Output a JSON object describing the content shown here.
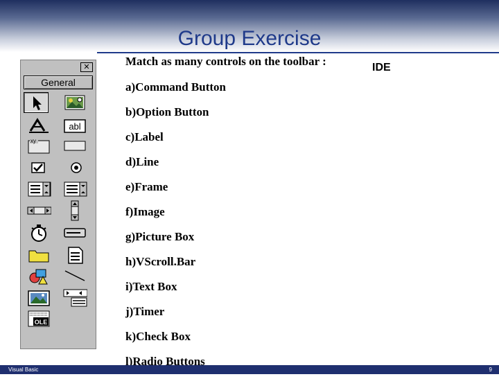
{
  "slide": {
    "title": "Group Exercise",
    "prompt": "Match as many controls on the toolbar :",
    "ide_label": "IDE",
    "options": [
      "a)Command Button",
      "b)Option Button",
      "c)Label",
      "d)Line",
      "e)Frame",
      "f)Image",
      "g)Picture Box",
      "h)VScroll.Bar",
      "i)Text Box",
      "j)Timer",
      "k)Check Box",
      "l)Radio Buttons"
    ]
  },
  "toolbox": {
    "close_glyph": "✕",
    "tab_label": "General",
    "tools": [
      {
        "icon": "pointer-icon",
        "label": ""
      },
      {
        "icon": "picturebox-icon",
        "label": ""
      },
      {
        "icon": "label-icon",
        "label": "A"
      },
      {
        "icon": "textbox-icon",
        "label": "abl"
      },
      {
        "icon": "frame-icon",
        "label": "xy"
      },
      {
        "icon": "commandbutton-icon",
        "label": ""
      },
      {
        "icon": "checkbox-icon",
        "label": ""
      },
      {
        "icon": "optionbutton-icon",
        "label": ""
      },
      {
        "icon": "combobox-icon",
        "label": ""
      },
      {
        "icon": "listbox-icon",
        "label": ""
      },
      {
        "icon": "hscrollbar-icon",
        "label": ""
      },
      {
        "icon": "vscrollbar-icon",
        "label": ""
      },
      {
        "icon": "timer-icon",
        "label": ""
      },
      {
        "icon": "drivelistbox-icon",
        "label": ""
      },
      {
        "icon": "dirlistbox-icon",
        "label": ""
      },
      {
        "icon": "filelistbox-icon",
        "label": ""
      },
      {
        "icon": "shape-icon",
        "label": ""
      },
      {
        "icon": "line-icon",
        "label": ""
      },
      {
        "icon": "image-icon",
        "label": ""
      },
      {
        "icon": "data-icon",
        "label": ""
      },
      {
        "icon": "ole-icon",
        "label": "OLE"
      }
    ]
  },
  "footer": {
    "left_text": "Visual Basic",
    "page_number": "9"
  },
  "colors": {
    "title": "#1f3a8a",
    "footer_bar": "#1f2f6f",
    "toolbox_bg": "#c0c0c0"
  }
}
